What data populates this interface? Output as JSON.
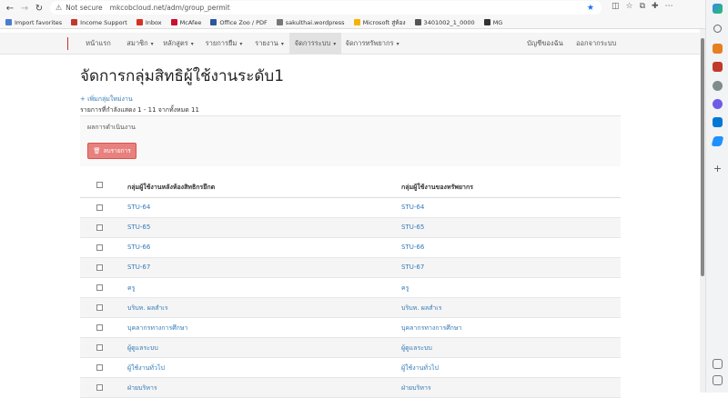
{
  "browser": {
    "security_label": "Not secure",
    "url": "mkcobcloud.net/adm/group_permit",
    "bookmarks": [
      {
        "label": "Import favorites",
        "color": "#4a7bd0"
      },
      {
        "label": "Income Support",
        "color": "#c0392b"
      },
      {
        "label": "Inbox",
        "color": "#d93025"
      },
      {
        "label": "McAfee",
        "color": "#c8102e"
      },
      {
        "label": "Office Zoo / PDF",
        "color": "#2b579a"
      },
      {
        "label": "sakulthai.wordpress",
        "color": "#777777"
      },
      {
        "label": "Microsoft สู่ห้อง",
        "color": "#f4b400"
      },
      {
        "label": "3401002_1_0000",
        "color": "#555555"
      },
      {
        "label": "MG",
        "color": "#333333"
      }
    ]
  },
  "navbar": {
    "items": [
      {
        "label": "หน้าแรก",
        "caret": ""
      },
      {
        "label": "สมาชิก",
        "caret": "▾"
      },
      {
        "label": "หลักสูตร",
        "caret": "▾"
      },
      {
        "label": "รายการยืม",
        "caret": "▾"
      },
      {
        "label": "รายงาน",
        "caret": "▾"
      },
      {
        "label": "จัดการระบบ",
        "caret": "▾"
      },
      {
        "label": "จัดการทรัพยากร",
        "caret": "▾"
      }
    ],
    "right_items": [
      "บัญชีของฉัน",
      "ออกจากระบบ"
    ],
    "active_color": "#e2e2e2"
  },
  "page": {
    "title": "จัดการกลุ่มสิทธิผู้ใช้งานระดับ1",
    "add_link": "+ เพิ่มกลุ่มใหม่งาน",
    "count_text": "รายการที่กำลังแสดง 1 - 11 จากทั้งหมด 11",
    "action_label": "ผลการดำเนินงาน",
    "delete_label": "ลบรายการ",
    "delete_icon": "trash-icon"
  },
  "table": {
    "headers": [
      "กลุ่มผู้ใช้งานหลังห้องสิทธิกรยึกต",
      "กลุ่มผู้ใช้งานของทรัพยากร"
    ],
    "rows": [
      [
        "STU-64",
        "STU-64"
      ],
      [
        "STU-65",
        "STU-65"
      ],
      [
        "STU-66",
        "STU-66"
      ],
      [
        "STU-67",
        "STU-67"
      ],
      [
        "ครู",
        "ครู"
      ],
      [
        "บริบห. ผลสำเร",
        "บริบห. ผลสำเร"
      ],
      [
        "บุคลากรทางการศึกษา",
        "บุคลากรทางการศึกษา"
      ],
      [
        "ผู้ดูแลระบบ",
        "ผู้ดูแลระบบ"
      ],
      [
        "ผู้ใช้งานทั่วไป",
        "ผู้ใช้งานทั่วไป"
      ],
      [
        "ฝ่ายบริหาร",
        "ฝ่ายบริหาร"
      ]
    ]
  }
}
